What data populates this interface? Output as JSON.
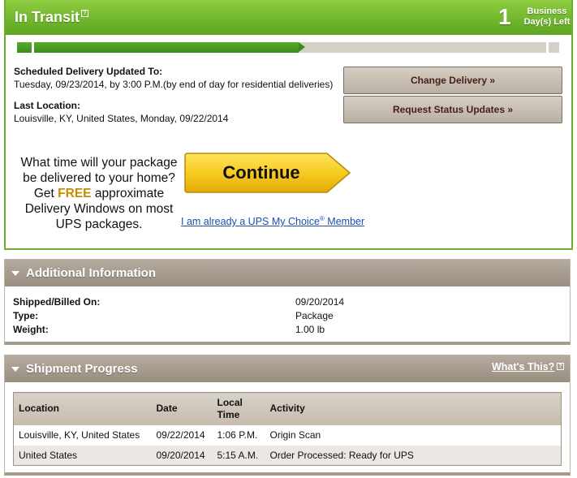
{
  "transit": {
    "title": "In Transit",
    "help_icon": "help-icon",
    "days_left_number": "1",
    "days_left_label_line1": "Business",
    "days_left_label_line2": "Day(s) Left",
    "progress_fraction": 0.52,
    "colors": {
      "accent": "#6fb52c",
      "progress": "#3d8b1c",
      "track": "#d4cfc7"
    }
  },
  "delivery": {
    "scheduled_label": "Scheduled Delivery Updated To:",
    "scheduled_value": "Tuesday, 09/23/2014, by 3:00 P.M.(by end of day for residential deliveries)",
    "last_location_label": "Last Location:",
    "last_location_value": "Louisville, KY, United States, Monday, 09/22/2014"
  },
  "actions": {
    "change_delivery": "Change Delivery »",
    "request_updates": "Request Status Updates »"
  },
  "promo": {
    "text_before": "What time will your package be delivered to your home? Get",
    "free": "FREE",
    "text_after": "approximate Delivery Windows on most UPS packages.",
    "continue_label": "Continue",
    "member_link_text": "I am already a UPS My Choice",
    "member_link_reg": "®",
    "member_link_suffix": " Member"
  },
  "additional": {
    "title": "Additional Information",
    "rows": [
      {
        "key": "Shipped/Billed On:",
        "value": "09/20/2014"
      },
      {
        "key": "Type:",
        "value": "Package"
      },
      {
        "key": "Weight:",
        "value": "1.00 lb"
      }
    ]
  },
  "shipment": {
    "title": "Shipment Progress",
    "whats_this": "What's This?",
    "columns": [
      "Location",
      "Date",
      "Local Time",
      "Activity"
    ],
    "rows": [
      [
        "Louisville, KY, United States",
        "09/22/2014",
        "1:06 P.M.",
        "Origin Scan"
      ],
      [
        "United States",
        "09/20/2014",
        "5:15 A.M.",
        "Order Processed: Ready for UPS"
      ]
    ]
  }
}
